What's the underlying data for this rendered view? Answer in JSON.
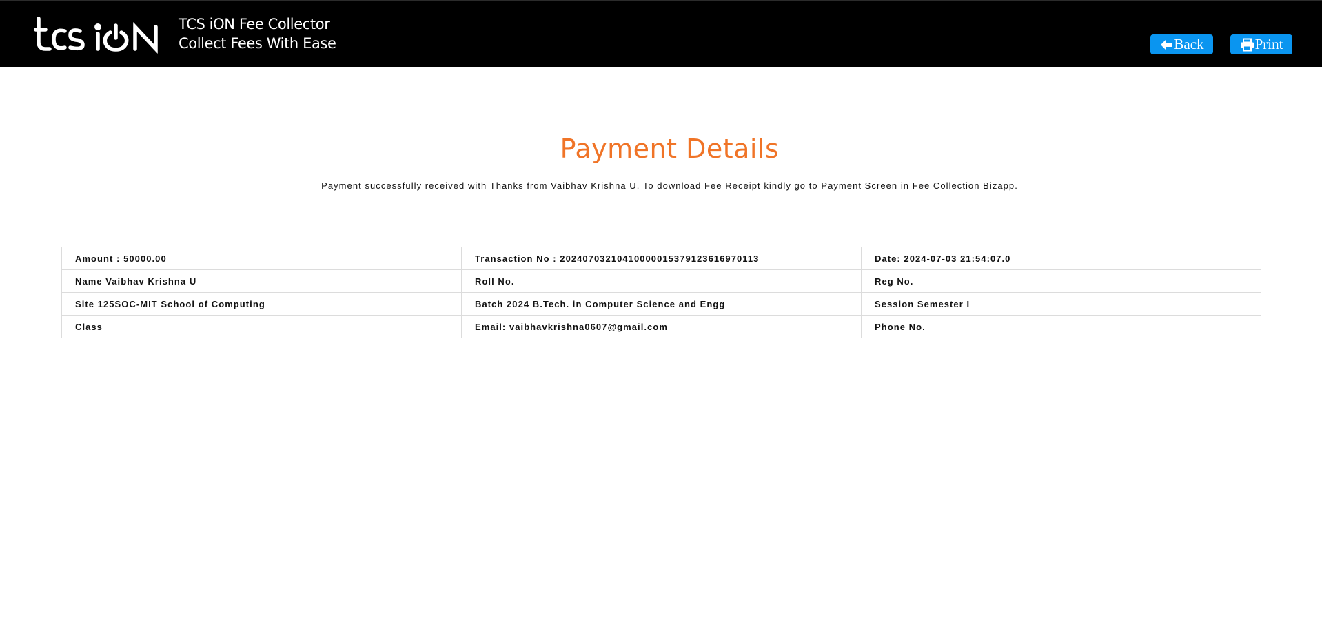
{
  "header": {
    "logo_text": "tcs iON",
    "brand_title": "TCS iON Fee Collector",
    "brand_tagline": "Collect Fees With Ease",
    "back_label": "Back",
    "print_label": "Print",
    "back_icon": "arrow-left-icon",
    "print_icon": "printer-icon",
    "button_color": "#0a95f0"
  },
  "main": {
    "title": "Payment Details",
    "title_color": "#f07427",
    "message": "Payment successfully received with Thanks from Vaibhav Krishna U. To download Fee Receipt kindly go to Payment Screen in Fee Collection Bizapp."
  },
  "details": {
    "rows": [
      [
        "Amount : 50000.00",
        "Transaction No : 20240703210410000015379123616970113",
        "Date: 2024-07-03 21:54:07.0"
      ],
      [
        "Name Vaibhav Krishna U",
        "Roll No.",
        "Reg No."
      ],
      [
        "Site 125SOC-MIT School of Computing",
        "Batch 2024 B.Tech. in Computer Science and Engg",
        "Session Semester I"
      ],
      [
        "Class",
        "Email: vaibhavkrishna0607@gmail.com",
        "Phone No."
      ]
    ]
  }
}
